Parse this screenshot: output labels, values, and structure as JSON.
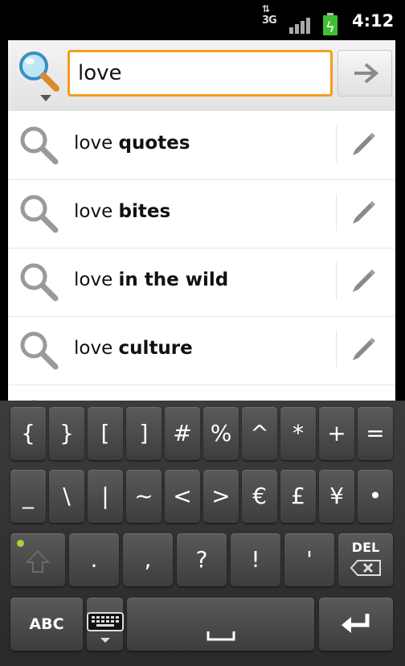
{
  "status_bar": {
    "network": "3G",
    "time": "4:12"
  },
  "search": {
    "query": "love"
  },
  "suggestions": [
    {
      "prefix": "love",
      "completion": "quotes"
    },
    {
      "prefix": "love",
      "completion": "bites"
    },
    {
      "prefix": "love",
      "completion": "in the wild"
    },
    {
      "prefix": "love",
      "completion": "culture"
    }
  ],
  "keyboard": {
    "row1": [
      "{",
      "}",
      "[",
      "]",
      "#",
      "%",
      "^",
      "*",
      "+",
      "="
    ],
    "row2": [
      "_",
      "\\",
      "|",
      "~",
      "<",
      ">",
      "€",
      "£",
      "¥",
      "•"
    ],
    "row3": [
      ".",
      ",",
      "?",
      "!",
      "'"
    ],
    "del_label": "DEL",
    "abc_label": "ABC"
  }
}
